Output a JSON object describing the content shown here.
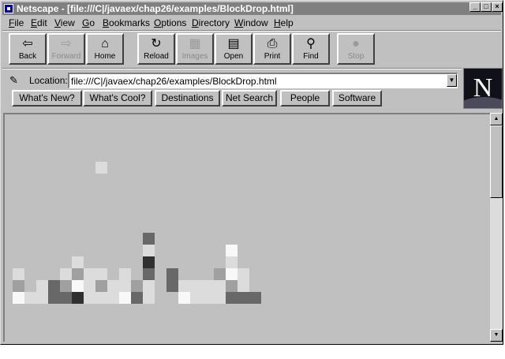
{
  "window": {
    "title": "Netscape - [file:///C|/javaex/chap26/examples/BlockDrop.html]"
  },
  "controls": {
    "minimize": "_",
    "maximize": "□",
    "close": "×"
  },
  "menu": [
    {
      "acc": "F",
      "rest": "ile"
    },
    {
      "acc": "E",
      "rest": "dit"
    },
    {
      "acc": "V",
      "rest": "iew"
    },
    {
      "acc": "G",
      "rest": "o"
    },
    {
      "acc": "B",
      "rest": "ookmarks"
    },
    {
      "acc": "O",
      "rest": "ptions"
    },
    {
      "acc": "D",
      "rest": "irectory"
    },
    {
      "acc": "W",
      "rest": "indow"
    },
    {
      "acc": "H",
      "rest": "elp"
    }
  ],
  "toolbar": {
    "back": {
      "label": "Back",
      "icon": "⇦"
    },
    "forward": {
      "label": "Forward",
      "icon": "⇨"
    },
    "home": {
      "label": "Home",
      "icon": "⌂"
    },
    "reload": {
      "label": "Reload",
      "icon": "↻"
    },
    "images": {
      "label": "Images",
      "icon": "▦"
    },
    "open": {
      "label": "Open",
      "icon": "▤"
    },
    "print": {
      "label": "Print",
      "icon": "⎙"
    },
    "find": {
      "label": "Find",
      "icon": "⚲"
    },
    "stop": {
      "label": "Stop",
      "icon": "●"
    }
  },
  "location": {
    "label": "Location:",
    "url": "file:///C|/javaex/chap26/examples/BlockDrop.html",
    "dropdown": "▼"
  },
  "directory_buttons": [
    "What's New?",
    "What's Cool?",
    "Destinations",
    "Net Search",
    "People",
    "Software"
  ],
  "logo": {
    "letter": "N"
  },
  "scrollbar": {
    "up": "▲",
    "down": "▼"
  },
  "block_colors": {
    "white": "#f8f8f8",
    "light": "#dcdcdc",
    "mid": "#a0a0a0",
    "dark": "#686868",
    "darkest": "#303030"
  }
}
